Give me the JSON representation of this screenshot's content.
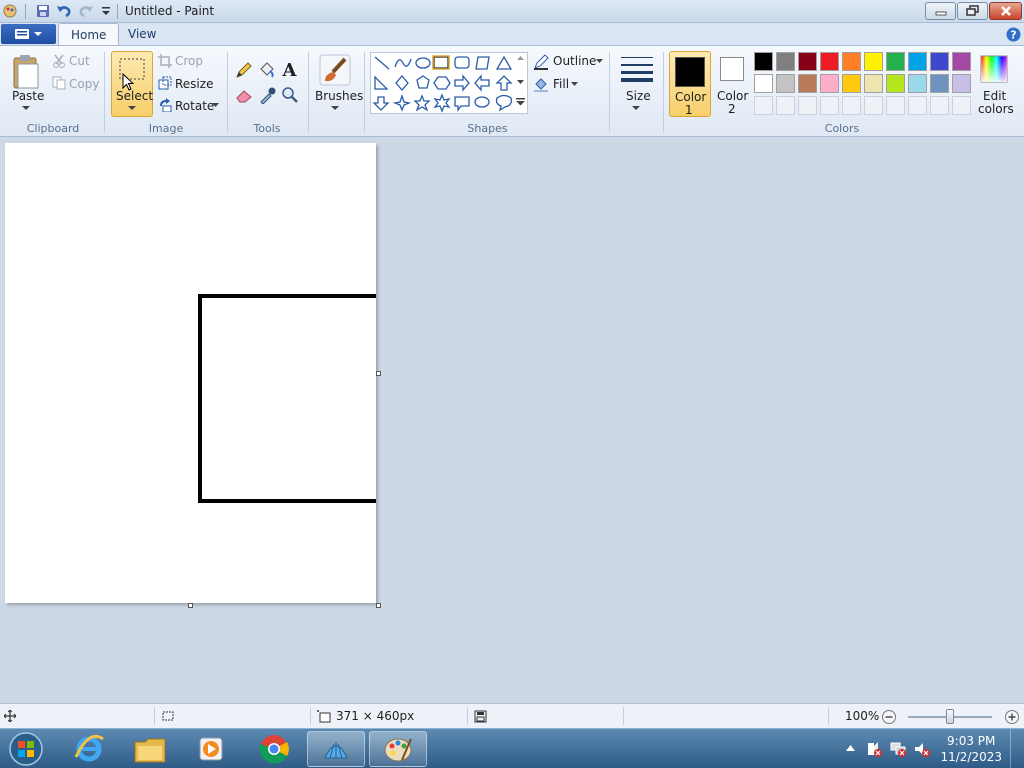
{
  "window": {
    "title": "Untitled - Paint"
  },
  "tabs": [
    {
      "label": "Home",
      "active": true
    },
    {
      "label": "View",
      "active": false
    }
  ],
  "clipboard": {
    "paste": "Paste",
    "cut": "Cut",
    "copy": "Copy",
    "label": "Clipboard"
  },
  "image": {
    "select": "Select",
    "crop": "Crop",
    "resize": "Resize",
    "rotate": "Rotate",
    "label": "Image"
  },
  "tools": {
    "label": "Tools",
    "text_tool_glyph": "A"
  },
  "brushes": {
    "label": "Brushes"
  },
  "shapes": {
    "outline": "Outline",
    "fill": "Fill",
    "label": "Shapes"
  },
  "size": {
    "label": "Size"
  },
  "colors": {
    "color1_line1": "Color",
    "color1_line2": "1",
    "color2_line1": "Color",
    "color2_line2": "2",
    "edit_line1": "Edit",
    "edit_line2": "colors",
    "label": "Colors",
    "color1_value": "#000000",
    "color2_value": "#ffffff",
    "palette_row1": [
      "#000000",
      "#7f7f7f",
      "#880015",
      "#ed1c24",
      "#ff7f27",
      "#fff200",
      "#22b14c",
      "#00a2e8",
      "#3f48cc",
      "#a349a4"
    ],
    "palette_row2": [
      "#ffffff",
      "#c3c3c3",
      "#b97a57",
      "#ffaec9",
      "#ffc90e",
      "#efe4b0",
      "#b5e61d",
      "#99d9ea",
      "#7092be",
      "#c8bfe7"
    ]
  },
  "status": {
    "canvas_size": "371 × 460px",
    "zoom": "100%"
  },
  "taskbar": {
    "time": "9:03 PM",
    "date": "11/2/2023"
  }
}
